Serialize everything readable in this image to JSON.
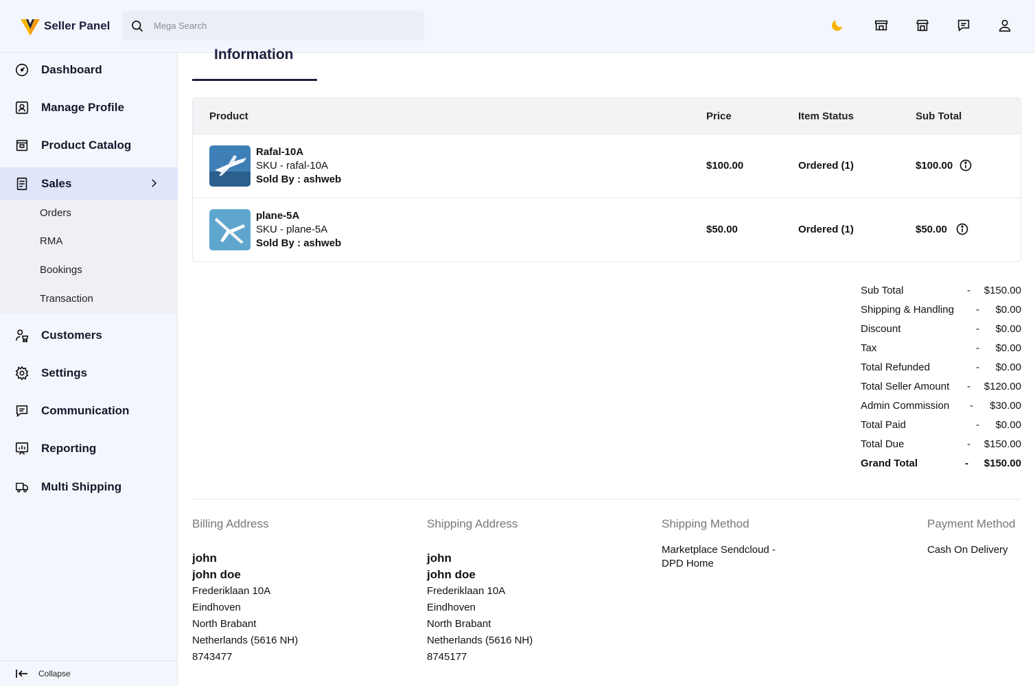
{
  "header": {
    "app_title": "Seller Panel",
    "search_placeholder": "Mega Search",
    "icons": [
      "moon-icon",
      "store-icon",
      "shop-icon",
      "chat-icon",
      "user-icon"
    ]
  },
  "sidebar": {
    "items": [
      {
        "label": "Dashboard",
        "icon": "dashboard-icon"
      },
      {
        "label": "Manage Profile",
        "icon": "profile-icon"
      },
      {
        "label": "Product Catalog",
        "icon": "catalog-icon"
      },
      {
        "label": "Sales",
        "icon": "sales-icon"
      },
      {
        "label": "Customers",
        "icon": "customers-icon"
      },
      {
        "label": "Settings",
        "icon": "settings-icon"
      },
      {
        "label": "Communication",
        "icon": "communication-icon"
      },
      {
        "label": "Reporting",
        "icon": "reporting-icon"
      },
      {
        "label": "Multi Shipping",
        "icon": "truck-icon"
      }
    ],
    "sales_submenu": [
      "Orders",
      "RMA",
      "Bookings",
      "Transaction"
    ],
    "collapse_label": "Collapse"
  },
  "main": {
    "tab_title": "Information",
    "table": {
      "headers": [
        "Product",
        "Price",
        "Item Status",
        "Sub Total"
      ],
      "rows": [
        {
          "name": "Rafal-10A",
          "sku": "SKU - rafal-10A",
          "sold_by_label": "Sold By :",
          "sold_by": "ashweb",
          "price": "$100.00",
          "status": "Ordered (1)",
          "subtotal": "$100.00"
        },
        {
          "name": "plane-5A",
          "sku": "SKU - plane-5A",
          "sold_by_label": "Sold By :",
          "sold_by": "ashweb",
          "price": "$50.00",
          "status": "Ordered (1)",
          "subtotal": "$50.00"
        }
      ]
    },
    "totals": [
      {
        "label": "Sub Total",
        "value": "$150.00"
      },
      {
        "label": "Shipping & Handling",
        "value": "$0.00"
      },
      {
        "label": "Discount",
        "value": "$0.00"
      },
      {
        "label": "Tax",
        "value": "$0.00"
      },
      {
        "label": "Total Refunded",
        "value": "$0.00"
      },
      {
        "label": "Total Seller Amount",
        "value": "$120.00"
      },
      {
        "label": "Admin Commission",
        "value": "$30.00"
      },
      {
        "label": "Total Paid",
        "value": "$0.00"
      },
      {
        "label": "Total Due",
        "value": "$150.00"
      },
      {
        "label": "Grand Total",
        "value": "$150.00"
      }
    ],
    "totals_separator": "-",
    "billing": {
      "title": "Billing Address",
      "first_name": "john",
      "full_name": "john doe",
      "street": "Frederiklaan 10A",
      "city": "Eindhoven",
      "region": "North Brabant",
      "country": "Netherlands (5616 NH)",
      "phone": "8743477"
    },
    "shipping": {
      "title": "Shipping Address",
      "first_name": "john",
      "full_name": "john doe",
      "street": "Frederiklaan 10A",
      "city": "Eindhoven",
      "region": "North Brabant",
      "country": "Netherlands (5616 NH)",
      "phone": "8745177"
    },
    "shipping_method": {
      "title": "Shipping Method",
      "line1": "Marketplace Sendcloud -",
      "line2": "DPD Home"
    },
    "payment_method": {
      "title": "Payment Method",
      "value": "Cash On Delivery"
    }
  },
  "colors": {
    "accent_yellow": "#f7b500",
    "navy": "#1a1f3c",
    "sidebar_bg": "#f4f6fd",
    "active_bg": "#dfe5fb"
  }
}
